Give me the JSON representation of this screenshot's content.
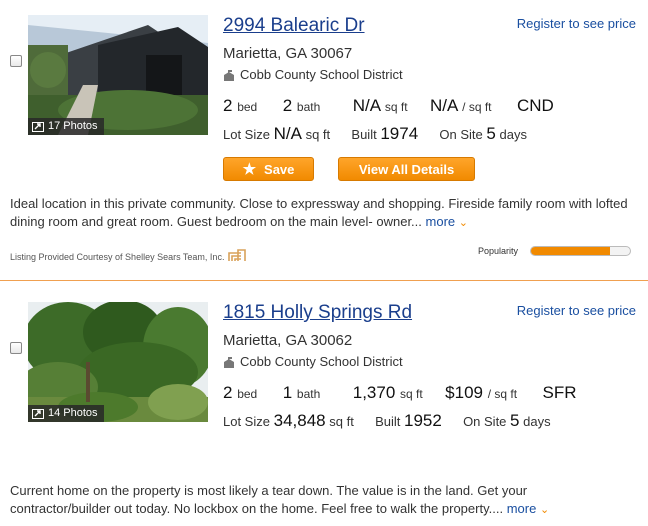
{
  "listings": [
    {
      "address": "2994 Balearic Dr",
      "register_label": "Register to see price",
      "city": "Marietta, GA 30067",
      "school": "Cobb County School District",
      "photo_count": "17 Photos",
      "beds": "2",
      "beds_unit": "bed",
      "baths": "2",
      "baths_unit": "bath",
      "sqft": "N/A",
      "sqft_unit": "sq ft",
      "price_per_sqft": "N/A",
      "price_per_sqft_unit": "/ sq ft",
      "type": "CND",
      "lot_size_label": "Lot Size",
      "lot_size": "N/A",
      "lot_size_unit": "sq ft",
      "built_label": "Built",
      "built": "1974",
      "on_site_label": "On Site",
      "on_site": "5",
      "on_site_unit": "days",
      "save_label": "Save",
      "details_label": "View All Details",
      "description": "Ideal location in this private community. Close to expressway and shopping. Fireside family room with lofted dining room and great room. Guest bedroom on the main level- owner...",
      "more_label": "more",
      "courtesy": "Listing Provided Courtesy of Shelley Sears Team, Inc.",
      "popularity_label": "Popularity",
      "popularity": 0.8
    },
    {
      "address": "1815 Holly Springs Rd",
      "register_label": "Register to see price",
      "city": "Marietta, GA 30062",
      "school": "Cobb County School District",
      "photo_count": "14 Photos",
      "beds": "2",
      "beds_unit": "bed",
      "baths": "1",
      "baths_unit": "bath",
      "sqft": "1,370",
      "sqft_unit": "sq ft",
      "price_per_sqft": "$109",
      "price_per_sqft_unit": "/ sq ft",
      "type": "SFR",
      "lot_size_label": "Lot Size",
      "lot_size": "34,848",
      "lot_size_unit": "sq ft",
      "built_label": "Built",
      "built": "1952",
      "on_site_label": "On Site",
      "on_site": "5",
      "on_site_unit": "days",
      "description": "Current home on the property is most likely a tear down. The value is in the land. Get your contractor/builder out today. No lockbox on the home. Feel free to walk the property....",
      "more_label": "more"
    }
  ],
  "colors": {
    "accent": "#f18a00",
    "link": "#1a3e8c",
    "divider": "#f0a050"
  }
}
